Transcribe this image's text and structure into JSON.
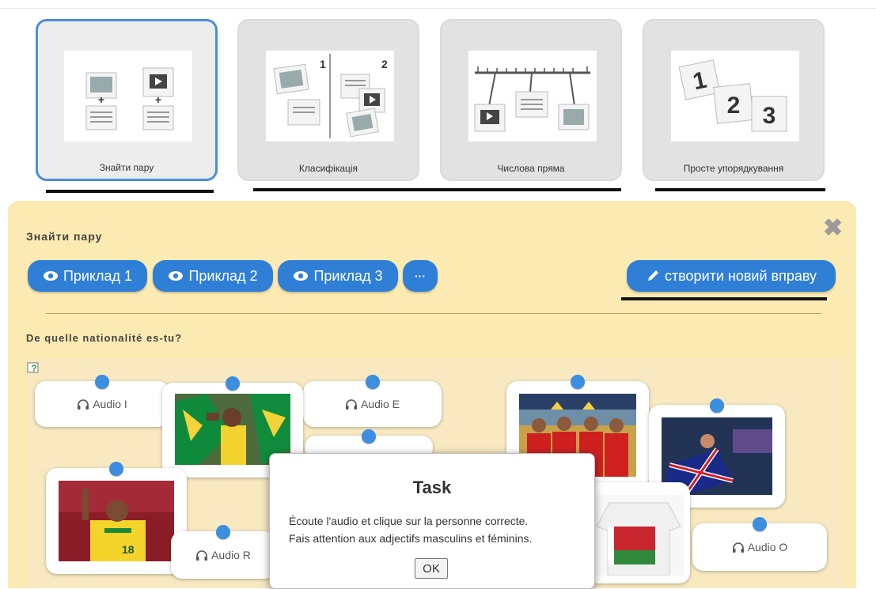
{
  "templates": [
    {
      "label": "Знайти пару",
      "selected": true,
      "icon": "find-pair-icon"
    },
    {
      "label": "Класифікація",
      "selected": false,
      "icon": "classification-icon"
    },
    {
      "label": "Числова пряма",
      "selected": false,
      "icon": "number-line-icon"
    },
    {
      "label": "Просте упорядкування",
      "selected": false,
      "icon": "simple-ordering-icon"
    }
  ],
  "panel": {
    "title": "Знайти пару",
    "examples": [
      "Приклад 1",
      "Приклад 2",
      "Приклад 3"
    ],
    "more_label": "···",
    "create_label": "створити новий вправу",
    "question": "De quelle nationalité es-tu?"
  },
  "cards": {
    "audio_i": "Audio I",
    "audio_e": "Audio E",
    "audio_r": "Audio R",
    "audio_o": "Audio O"
  },
  "dialog": {
    "title": "Task",
    "line1": "Écoute l'audio et clique sur la personne correcte.",
    "line2": "Fais attention aux adjectifs masculins et féminins.",
    "ok": "OK"
  },
  "colors": {
    "accent_blue": "#2f7fd6",
    "panel_bg": "#fbeab1",
    "pin_blue": "#3b8ee0"
  }
}
